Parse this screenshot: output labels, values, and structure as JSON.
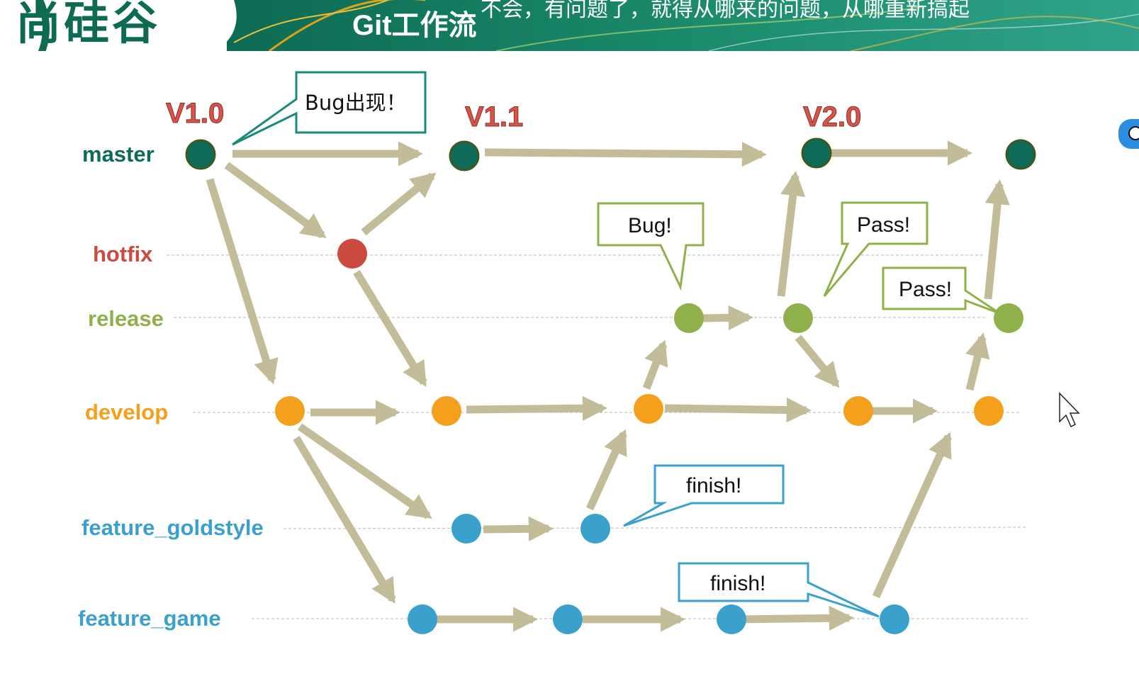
{
  "header": {
    "logo_text": "尚硅谷",
    "title": "Git工作流",
    "subtitle": "不会，有问题了，就得从哪来的问题，从哪重新搞起"
  },
  "colors": {
    "header_bg": "#0f7a5c",
    "master": "#0e6b5a",
    "hotfix": "#cc4a3e",
    "release": "#8fb04a",
    "develop": "#f5a01c",
    "feature": "#3aa0cc",
    "arrow": "#c2bd98",
    "callout_green": "#8fb04a",
    "callout_teal": "#1a8a7a",
    "callout_blue": "#3aa0cc",
    "version": "#d9534a"
  },
  "branches": [
    {
      "id": "master",
      "label": "master",
      "color": "#0e6b5a"
    },
    {
      "id": "hotfix",
      "label": "hotfix",
      "color": "#cc4a3e"
    },
    {
      "id": "release",
      "label": "release",
      "color": "#8fb04a"
    },
    {
      "id": "develop",
      "label": "develop",
      "color": "#f5a01c"
    },
    {
      "id": "feature_goldstyle",
      "label": "feature_goldstyle",
      "color": "#3aa0cc"
    },
    {
      "id": "feature_game",
      "label": "feature_game",
      "color": "#3aa0cc"
    }
  ],
  "versions": [
    "V1.0",
    "V1.1",
    "V2.0"
  ],
  "callouts": {
    "bug_appears": "Bug出现！",
    "bug": "Bug!",
    "pass1": "Pass!",
    "pass2": "Pass!",
    "finish1": "finish!",
    "finish2": "finish!"
  }
}
